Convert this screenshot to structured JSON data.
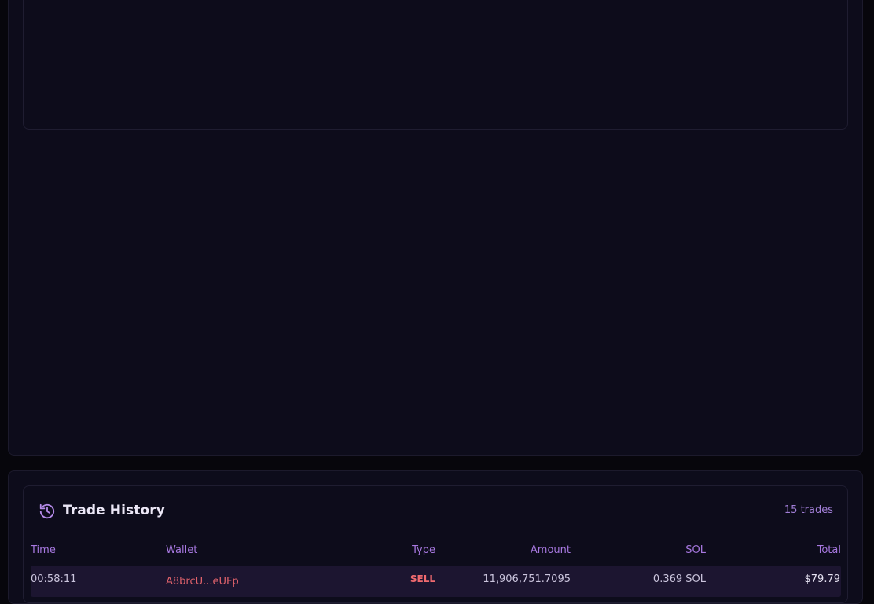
{
  "trade_history": {
    "title": "Trade History",
    "count_label": "15 trades",
    "icon": "history-icon",
    "columns": {
      "time": "Time",
      "wallet": "Wallet",
      "type": "Type",
      "amount": "Amount",
      "sol": "SOL",
      "total": "Total"
    },
    "rows": [
      {
        "time": "00:58:11",
        "wallet": "A8brcU...eUFp",
        "type": "SELL",
        "amount": "11,906,751.7095",
        "sol": "0.369 SOL",
        "total": "$79.79"
      }
    ]
  },
  "colors": {
    "accent": "#a778e0",
    "sell": "#f06a6f",
    "background": "#0d0c1b"
  }
}
